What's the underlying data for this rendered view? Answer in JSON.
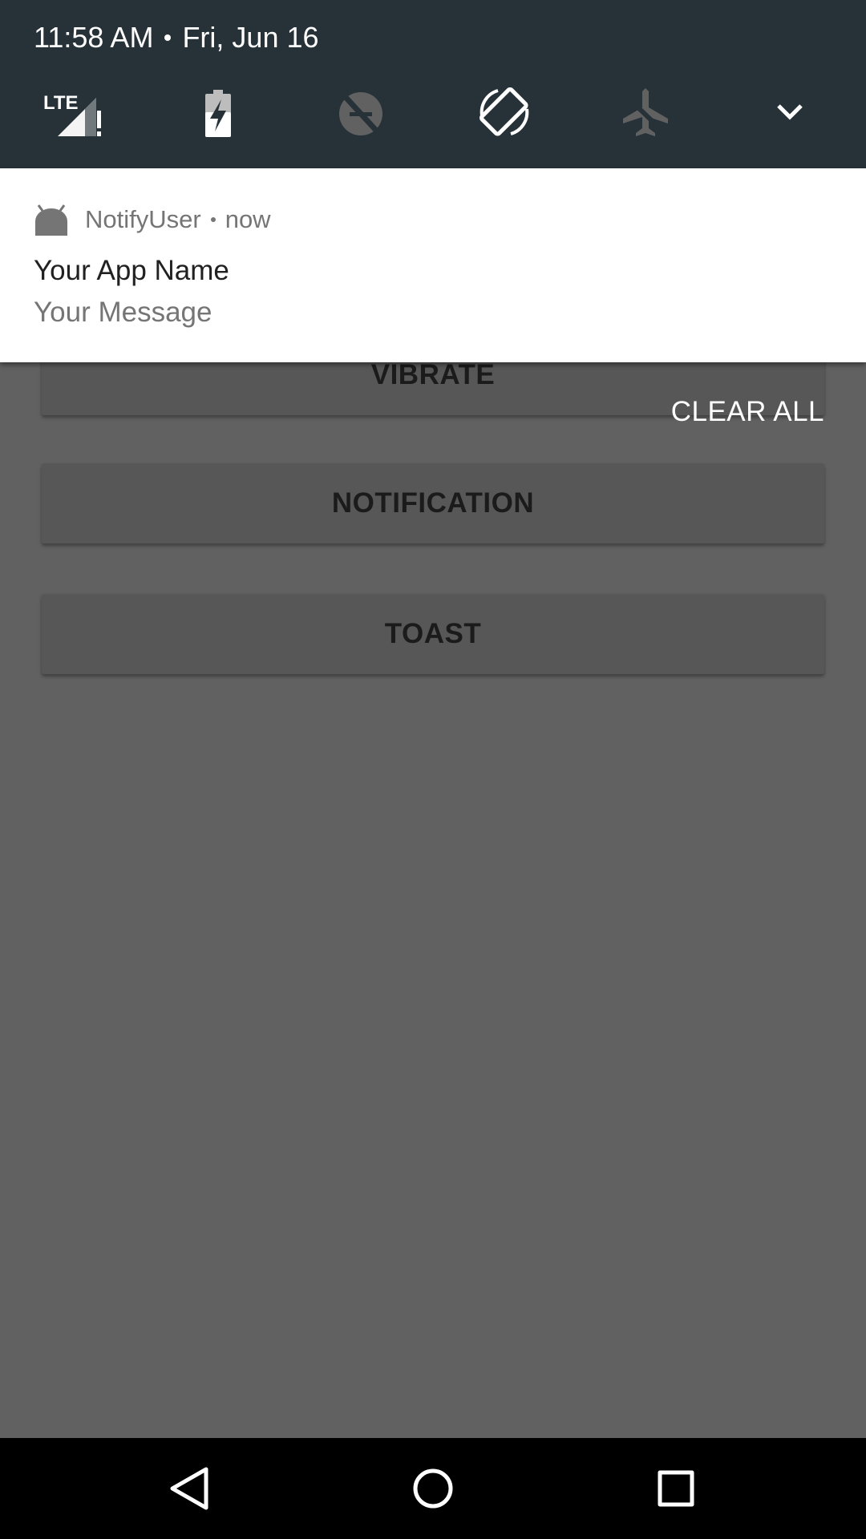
{
  "status": {
    "time": "11:58 AM",
    "date": "Fri, Jun 16"
  },
  "quick_settings": {
    "icons": [
      {
        "name": "lte-signal-alert-icon",
        "text": "LTE"
      },
      {
        "name": "battery-charging-icon"
      },
      {
        "name": "data-saver-off-icon"
      },
      {
        "name": "auto-rotate-icon"
      },
      {
        "name": "airplane-mode-off-icon"
      },
      {
        "name": "expand-chevron-icon"
      }
    ]
  },
  "notification": {
    "app_name": "NotifyUser",
    "time": "now",
    "title": "Your App Name",
    "text": "Your Message"
  },
  "clear_all_label": "CLEAR ALL",
  "app": {
    "buttons": {
      "vibrate": "VIBRATE",
      "notification": "NOTIFICATION",
      "toast": "TOAST"
    }
  },
  "colors": {
    "qs_background": "#263238",
    "scrim_background": "#616161",
    "card_background": "#ffffff",
    "nav_background": "#000000"
  }
}
